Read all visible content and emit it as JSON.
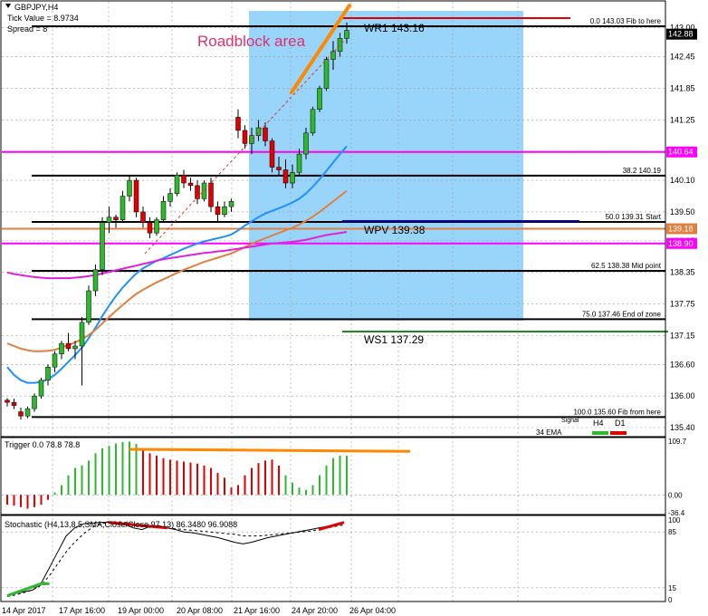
{
  "header": {
    "symbol": "GBPJPY,H4",
    "tick_value": "Tick Value = 8.9734",
    "spread": "Spread = 8"
  },
  "annotations": {
    "roadblock": "Roadblock area",
    "wr1": "WR1   143.16",
    "wpv": "WPV   139.38",
    "ws1": "WS1   137.29",
    "legend_h4": "H4",
    "legend_d1": "D1",
    "legend_lbl": "34 EMA",
    "legend_lbl_top": "Signal"
  },
  "fib_levels": [
    {
      "value": 143.03,
      "pct": "0.0",
      "price": "143.03",
      "note": "Fib to here"
    },
    {
      "value": 140.19,
      "pct": "38.2",
      "price": "140.19",
      "note": ""
    },
    {
      "value": 139.31,
      "pct": "50.0",
      "price": "139.31",
      "note": "Start"
    },
    {
      "value": 138.38,
      "pct": "62.5",
      "price": "138.38",
      "note": "Mid point"
    },
    {
      "value": 137.46,
      "pct": "75.0",
      "price": "137.46",
      "note": "End of zone"
    },
    {
      "value": 135.6,
      "pct": "100.0",
      "price": "135.60",
      "note": "Fib from here"
    }
  ],
  "price_axis": {
    "ticks": [
      "143.00",
      "142.45",
      "141.85",
      "141.25",
      "140.65",
      "140.10",
      "139.50",
      "138.95",
      "138.35",
      "137.75",
      "137.15",
      "136.60",
      "136.00",
      "135.40"
    ],
    "tags": [
      {
        "value": 142.88,
        "text": "142.88",
        "color": "#000000"
      },
      {
        "value": 140.64,
        "text": "140.64",
        "color": "#ff00ff"
      },
      {
        "value": 139.18,
        "text": "139.18",
        "color": "#e08040"
      },
      {
        "value": 138.9,
        "text": "138.90",
        "color": "#ff00ff"
      }
    ]
  },
  "time_axis": [
    "14 Apr 2017",
    "17 Apr 16:00",
    "19 Apr 00:00",
    "20 Apr 08:00",
    "21 Apr 16:00",
    "24 Apr 20:00",
    "26 Apr 04:00"
  ],
  "trigger_panel": {
    "title": "Trigger 0.0 78.8 78.8",
    "ticks": [
      "109.7",
      "0.00",
      "-36.4"
    ]
  },
  "stoch_panel": {
    "title": "Stochastic (H4,13,8,5,SMA,Close/Close,97.13) 86.3480 96.9088",
    "ticks": [
      "100",
      "85",
      "15",
      "0"
    ]
  },
  "chart_data": {
    "type": "candlestick",
    "title": "GBPJPY,H4",
    "ylim": [
      135.4,
      143.15
    ],
    "horizontal_lines": [
      {
        "value": 140.64,
        "color": "#ff00ff"
      },
      {
        "value": 139.18,
        "color": "#e08040"
      },
      {
        "value": 138.9,
        "color": "#ff00ff"
      }
    ],
    "pivots": {
      "WR1": 143.16,
      "WPV": 139.38,
      "WS1": 137.29
    },
    "candles": [
      [
        135.92,
        135.96,
        135.8,
        135.88
      ],
      [
        135.88,
        135.95,
        135.75,
        135.82
      ],
      [
        135.7,
        135.78,
        135.55,
        135.62
      ],
      [
        135.62,
        135.8,
        135.58,
        135.76
      ],
      [
        135.76,
        136.05,
        135.7,
        136.0
      ],
      [
        136.0,
        136.35,
        135.95,
        136.3
      ],
      [
        136.3,
        136.6,
        136.2,
        136.55
      ],
      [
        136.55,
        136.85,
        136.45,
        136.8
      ],
      [
        136.8,
        137.05,
        136.7,
        137.0
      ],
      [
        137.0,
        137.2,
        136.85,
        136.9
      ],
      [
        136.9,
        137.05,
        136.7,
        136.95
      ],
      [
        136.95,
        137.5,
        136.2,
        137.4
      ],
      [
        137.4,
        138.1,
        137.35,
        138.0
      ],
      [
        138.0,
        138.5,
        137.9,
        138.4
      ],
      [
        138.4,
        139.4,
        138.3,
        139.3
      ],
      [
        139.3,
        139.6,
        139.1,
        139.4
      ],
      [
        139.4,
        139.45,
        139.2,
        139.35
      ],
      [
        139.35,
        139.9,
        139.3,
        139.8
      ],
      [
        139.8,
        140.2,
        139.7,
        140.1
      ],
      [
        140.1,
        140.15,
        139.4,
        139.5
      ],
      [
        139.5,
        139.6,
        139.2,
        139.3
      ],
      [
        139.3,
        139.4,
        139.0,
        139.1
      ],
      [
        139.1,
        139.4,
        139.05,
        139.35
      ],
      [
        139.35,
        139.8,
        139.3,
        139.7
      ],
      [
        139.7,
        139.95,
        139.6,
        139.85
      ],
      [
        139.85,
        140.25,
        139.8,
        140.2
      ],
      [
        140.2,
        140.3,
        139.95,
        140.05
      ],
      [
        140.05,
        140.15,
        139.9,
        140.0
      ],
      [
        140.0,
        140.1,
        139.65,
        139.75
      ],
      [
        139.75,
        140.1,
        139.7,
        140.05
      ],
      [
        140.05,
        140.15,
        139.5,
        139.6
      ],
      [
        139.6,
        139.7,
        139.3,
        139.45
      ],
      [
        139.45,
        139.7,
        139.4,
        139.6
      ],
      [
        139.6,
        139.75,
        139.5,
        139.7
      ],
      [
        141.3,
        141.45,
        140.9,
        141.05
      ],
      [
        141.05,
        141.15,
        140.7,
        140.8
      ],
      [
        140.8,
        141.1,
        140.6,
        140.95
      ],
      [
        140.95,
        141.25,
        140.85,
        141.1
      ],
      [
        141.1,
        141.2,
        140.75,
        140.85
      ],
      [
        140.85,
        140.9,
        140.25,
        140.35
      ],
      [
        140.35,
        140.55,
        140.2,
        140.3
      ],
      [
        140.3,
        140.5,
        139.95,
        140.05
      ],
      [
        140.05,
        140.4,
        139.95,
        140.25
      ],
      [
        140.25,
        140.7,
        140.2,
        140.6
      ],
      [
        140.6,
        141.1,
        140.5,
        141.0
      ],
      [
        141.0,
        141.5,
        140.95,
        141.45
      ],
      [
        141.45,
        141.9,
        141.4,
        141.85
      ],
      [
        141.85,
        142.45,
        141.8,
        142.4
      ],
      [
        142.4,
        142.75,
        142.2,
        142.55
      ],
      [
        142.55,
        142.9,
        142.45,
        142.8
      ],
      [
        142.8,
        143.1,
        142.7,
        142.95
      ]
    ],
    "moving_averages": [
      {
        "name": "",
        "color": "#1e90ff",
        "values": [
          136.55,
          136.4,
          136.3,
          136.25,
          136.25,
          136.27,
          136.32,
          136.4,
          136.52,
          136.65,
          136.78,
          136.92,
          137.1,
          137.3,
          137.52,
          137.72,
          137.9,
          138.06,
          138.2,
          138.33,
          138.43,
          138.5,
          138.57,
          138.62,
          138.68,
          138.74,
          138.8,
          138.85,
          138.9,
          138.94,
          138.97,
          139.0,
          139.03,
          139.07,
          139.15,
          139.24,
          139.32,
          139.4,
          139.47,
          139.52,
          139.57,
          139.62,
          139.68,
          139.75,
          139.85,
          139.98,
          140.12,
          140.28,
          140.44,
          140.6,
          140.75
        ]
      },
      {
        "name": "",
        "color": "#e08040",
        "values": [
          137.0,
          136.95,
          136.9,
          136.87,
          136.85,
          136.85,
          136.86,
          136.88,
          136.92,
          136.97,
          137.02,
          137.08,
          137.16,
          137.26,
          137.38,
          137.5,
          137.62,
          137.73,
          137.84,
          137.94,
          138.02,
          138.09,
          138.16,
          138.22,
          138.28,
          138.34,
          138.4,
          138.45,
          138.5,
          138.55,
          138.59,
          138.63,
          138.67,
          138.71,
          138.77,
          138.83,
          138.89,
          138.95,
          139.0,
          139.05,
          139.1,
          139.15,
          139.2,
          139.26,
          139.33,
          139.41,
          139.5,
          139.6,
          139.7,
          139.8,
          139.9
        ]
      },
      {
        "name": "",
        "color": "#e020e0",
        "values": [
          138.35,
          138.32,
          138.3,
          138.28,
          138.26,
          138.25,
          138.24,
          138.24,
          138.24,
          138.24,
          138.25,
          138.26,
          138.28,
          138.3,
          138.33,
          138.36,
          138.39,
          138.42,
          138.45,
          138.48,
          138.51,
          138.54,
          138.57,
          138.6,
          138.62,
          138.64,
          138.66,
          138.68,
          138.7,
          138.72,
          138.73,
          138.75,
          138.76,
          138.78,
          138.8,
          138.82,
          138.84,
          138.86,
          138.88,
          138.9,
          138.91,
          138.92,
          138.93,
          138.95,
          138.97,
          139.0,
          139.03,
          139.06,
          139.08,
          139.1,
          139.12
        ]
      }
    ],
    "trigger_histogram": [
      -20,
      -22,
      -25,
      -28,
      -25,
      -20,
      -10,
      5,
      20,
      40,
      55,
      60,
      70,
      85,
      95,
      100,
      105,
      108,
      109,
      104,
      95,
      85,
      80,
      75,
      72,
      70,
      68,
      66,
      64,
      60,
      55,
      45,
      35,
      15,
      20,
      40,
      55,
      65,
      70,
      72,
      60,
      40,
      25,
      15,
      10,
      20,
      40,
      60,
      75,
      80,
      80
    ],
    "trigger_line": [
      [
        18,
        93
      ],
      [
        54,
        89
      ]
    ],
    "stoch_main": [
      5,
      8,
      10,
      12,
      20,
      40,
      60,
      80,
      90,
      95,
      96,
      97,
      97,
      96,
      94,
      90,
      88,
      92,
      93,
      90,
      88,
      85,
      84,
      82,
      80,
      78,
      75,
      72,
      70,
      72,
      75,
      78,
      80,
      82,
      84,
      86,
      88,
      90,
      92,
      95,
      97
    ],
    "stoch_signal": [
      4,
      6,
      9,
      12,
      18,
      30,
      45,
      60,
      72,
      82,
      90,
      95,
      97,
      98,
      97,
      95,
      93,
      92,
      91,
      90,
      89,
      88,
      87,
      86,
      85,
      84,
      83,
      82,
      80,
      80,
      80,
      81,
      82,
      83,
      84,
      85,
      86,
      88,
      90,
      92,
      94
    ]
  }
}
